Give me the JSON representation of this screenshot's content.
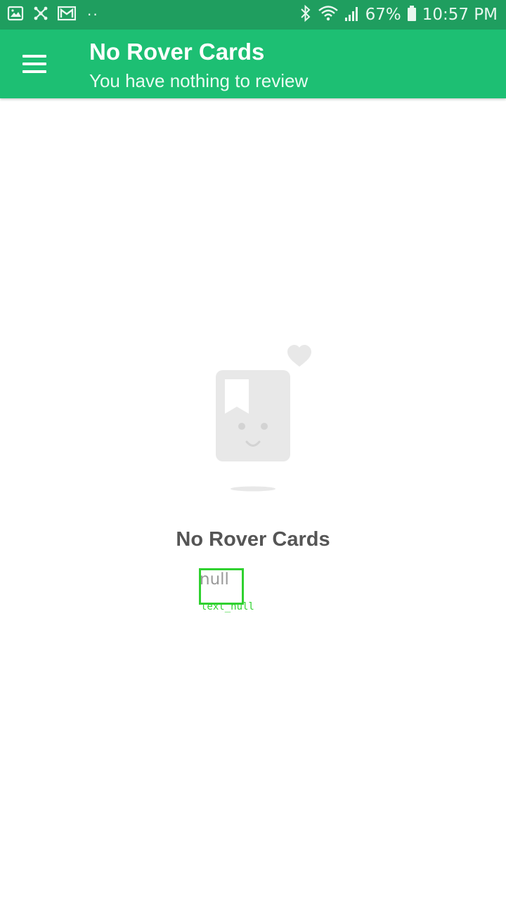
{
  "status_bar": {
    "battery": "67%",
    "time": "10:57 PM",
    "overflow_dots": "··",
    "notification_icons": [
      "gallery-icon",
      "network-icon",
      "mail-icon"
    ],
    "system_icons": [
      "bluetooth-icon",
      "wifi-icon",
      "signal-icon",
      "battery-icon"
    ]
  },
  "app_bar": {
    "title": "No Rover Cards",
    "subtitle": "You have nothing to review",
    "menu_icon": "hamburger-menu-icon",
    "color": "#1dbf73"
  },
  "empty_state": {
    "illustration": "empty-card-face-icon",
    "title": "No Rover Cards",
    "message": "null"
  },
  "debug_overlay": {
    "label": "text_null",
    "color": "#2fd12f"
  },
  "colors": {
    "status_bar": "#1f9e5f",
    "accent": "#1dbf73",
    "illustration": "#e8e8e8",
    "title_text": "#555555"
  }
}
